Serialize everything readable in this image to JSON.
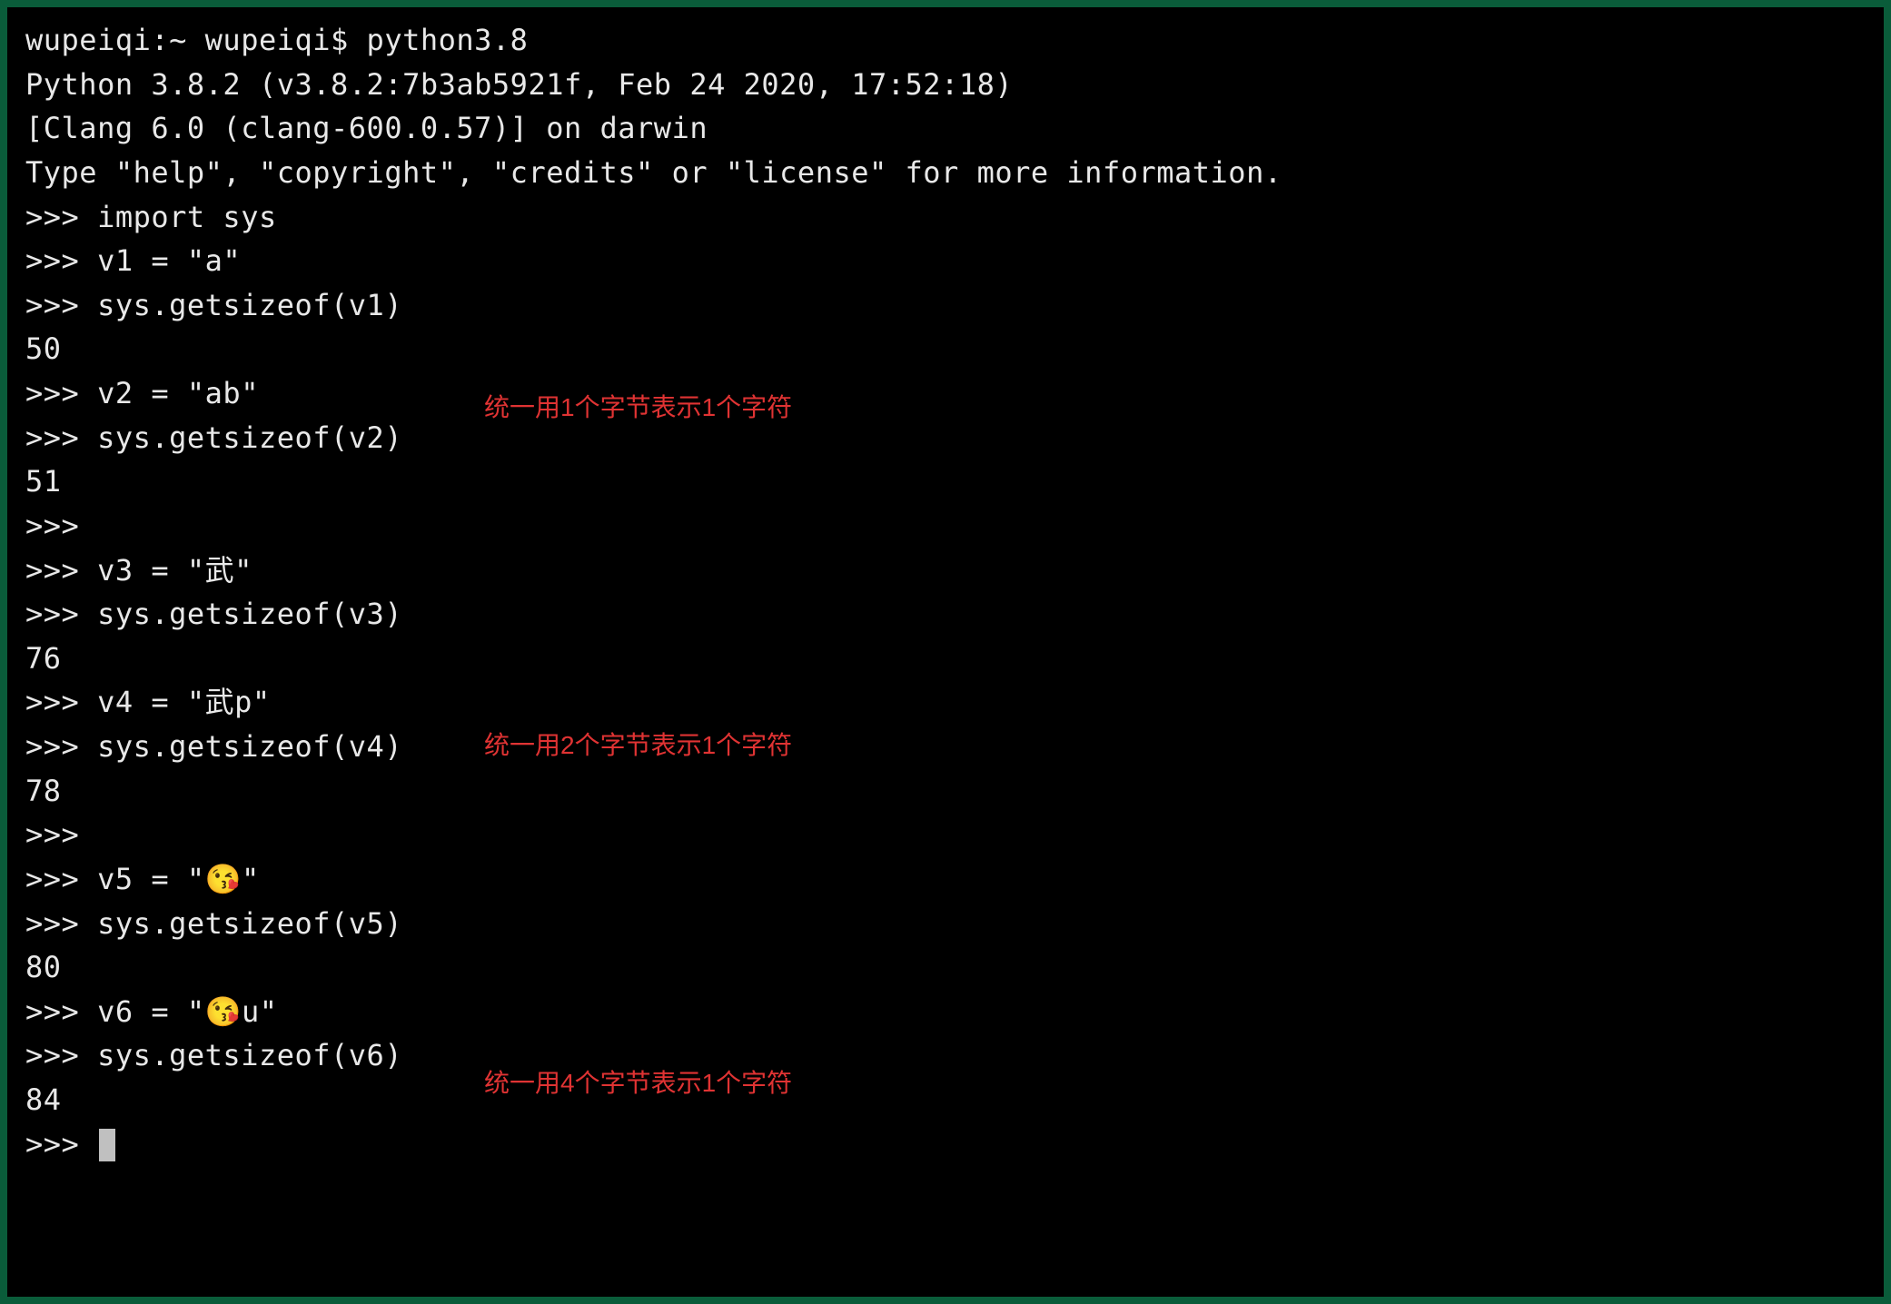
{
  "terminal": {
    "prompt_line": "wupeiqi:~ wupeiqi$ python3.8",
    "header_lines": [
      "Python 3.8.2 (v3.8.2:7b3ab5921f, Feb 24 2020, 17:52:18)",
      "[Clang 6.0 (clang-600.0.57)] on darwin",
      "Type \"help\", \"copyright\", \"credits\" or \"license\" for more information."
    ],
    "repl_lines": [
      ">>> import sys",
      ">>> v1 = \"a\"",
      ">>> sys.getsizeof(v1)",
      "50",
      ">>> v2 = \"ab\"",
      ">>> sys.getsizeof(v2)",
      "51",
      ">>>",
      ">>> v3 = \"武\"",
      ">>> sys.getsizeof(v3)",
      "76",
      ">>> v4 = \"武p\"",
      ">>> sys.getsizeof(v4)",
      "78",
      ">>>",
      ">>> v5 = \"😘\"",
      ">>> sys.getsizeof(v5)",
      "80",
      ">>> v6 = \"😘u\"",
      ">>> sys.getsizeof(v6)",
      "84",
      ">>> "
    ],
    "annotations": [
      "统一用1个字节表示1个字符",
      "统一用2个字节表示1个字符",
      "统一用4个字节表示1个字符"
    ]
  }
}
